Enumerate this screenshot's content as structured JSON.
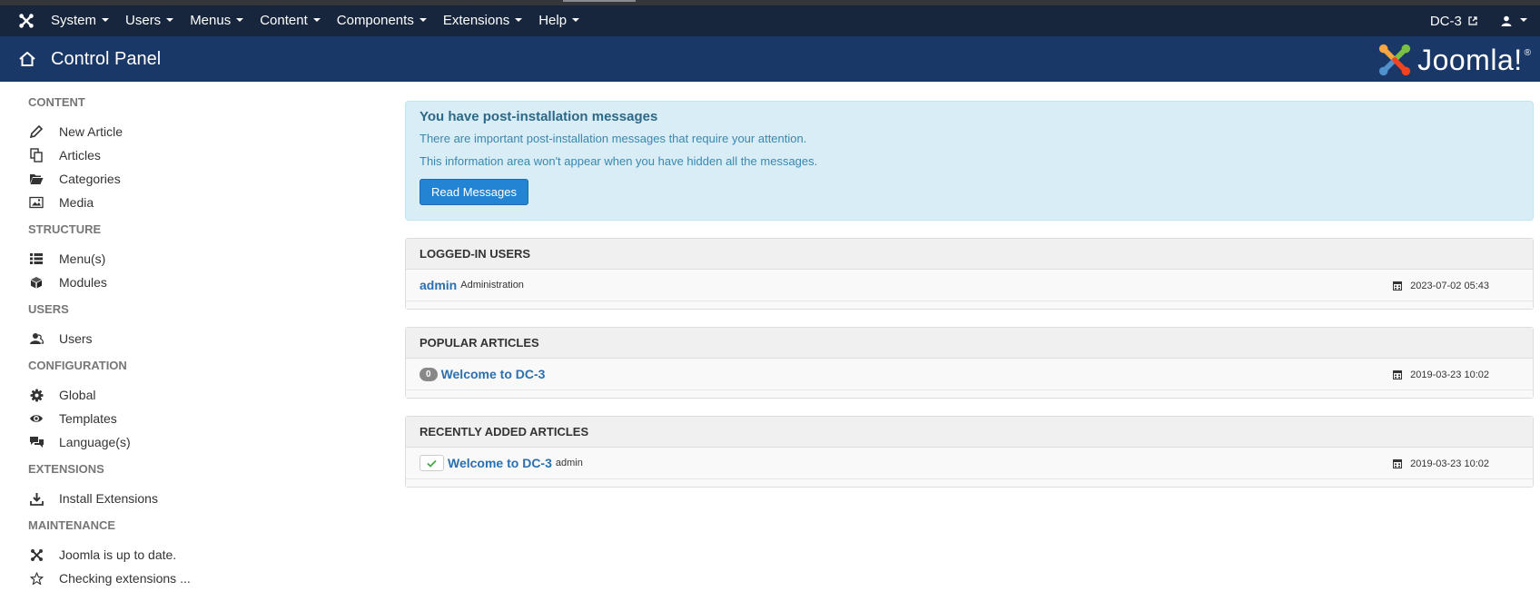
{
  "topbar": {
    "menus": [
      "System",
      "Users",
      "Menus",
      "Content",
      "Components",
      "Extensions",
      "Help"
    ],
    "site_name": "DC-3"
  },
  "header": {
    "title": "Control Panel",
    "logo_text": "Joomla!"
  },
  "sidebar": {
    "groups": [
      {
        "heading": "CONTENT",
        "items": [
          {
            "label": "New Article",
            "icon": "pencil-icon"
          },
          {
            "label": "Articles",
            "icon": "copy-icon"
          },
          {
            "label": "Categories",
            "icon": "folder-open-icon"
          },
          {
            "label": "Media",
            "icon": "image-icon"
          }
        ]
      },
      {
        "heading": "STRUCTURE",
        "items": [
          {
            "label": "Menu(s)",
            "icon": "list-icon"
          },
          {
            "label": "Modules",
            "icon": "cube-icon"
          }
        ]
      },
      {
        "heading": "USERS",
        "items": [
          {
            "label": "Users",
            "icon": "users-icon"
          }
        ]
      },
      {
        "heading": "CONFIGURATION",
        "items": [
          {
            "label": "Global",
            "icon": "cog-icon"
          },
          {
            "label": "Templates",
            "icon": "eye-icon"
          },
          {
            "label": "Language(s)",
            "icon": "comments-icon"
          }
        ]
      },
      {
        "heading": "EXTENSIONS",
        "items": [
          {
            "label": "Install Extensions",
            "icon": "download-icon"
          }
        ]
      },
      {
        "heading": "MAINTENANCE",
        "items": [
          {
            "label": "Joomla is up to date.",
            "icon": "joomla-icon"
          },
          {
            "label": "Checking extensions ...",
            "icon": "star-icon"
          }
        ]
      }
    ]
  },
  "alert": {
    "title": "You have post-installation messages",
    "line1": "There are important post-installation messages that require your attention.",
    "line2": "This information area won't appear when you have hidden all the messages.",
    "button": "Read Messages"
  },
  "logged_in": {
    "heading": "LOGGED-IN USERS",
    "user": "admin",
    "role": "Administration",
    "date": "2023-07-02 05:43"
  },
  "popular": {
    "heading": "POPULAR ARTICLES",
    "hits": "0",
    "title": "Welcome to DC-3",
    "date": "2019-03-23 10:02"
  },
  "recent": {
    "heading": "RECENTLY ADDED ARTICLES",
    "title": "Welcome to DC-3",
    "author": "admin",
    "date": "2019-03-23 10:02"
  },
  "colors": {
    "navbar": "#17263d",
    "header": "#1a3867",
    "accent": "#2384d3",
    "link": "#2a6fb0"
  }
}
